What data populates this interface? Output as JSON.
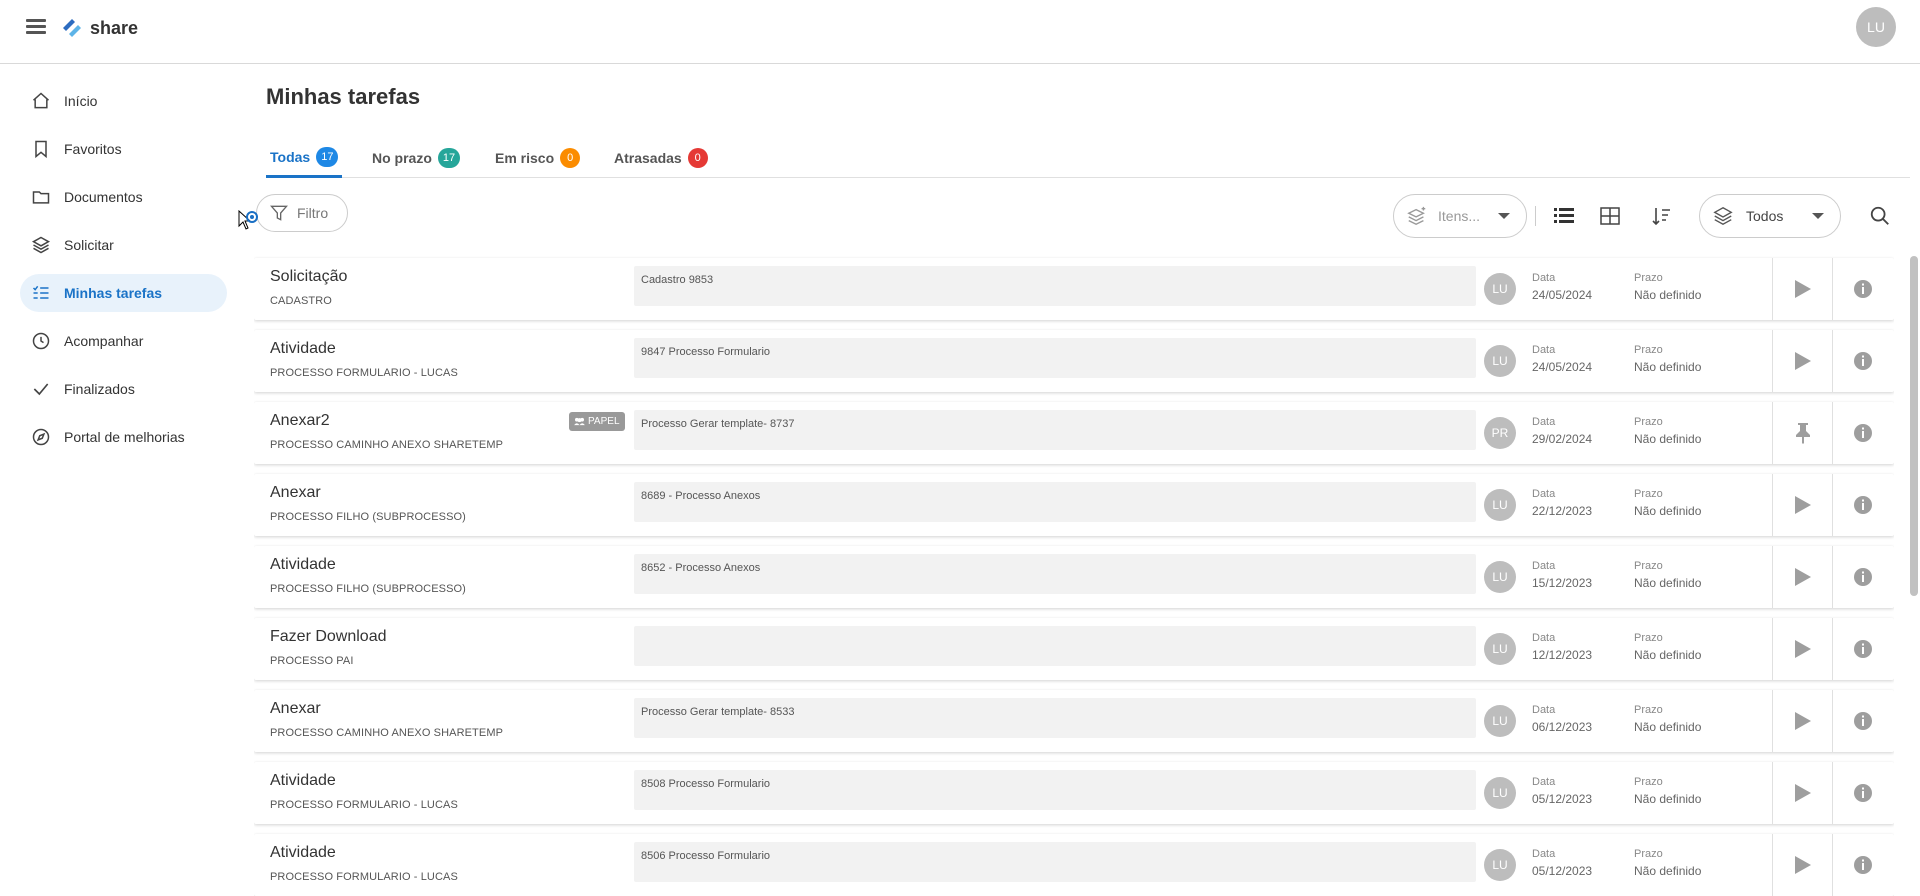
{
  "app": {
    "name": "share",
    "user_initials": "LU"
  },
  "sidebar": {
    "items": [
      {
        "label": "Início",
        "icon": "home-icon"
      },
      {
        "label": "Favoritos",
        "icon": "bookmark-icon"
      },
      {
        "label": "Documentos",
        "icon": "folder-icon"
      },
      {
        "label": "Solicitar",
        "icon": "layers-icon"
      },
      {
        "label": "Minhas tarefas",
        "icon": "task-list-icon",
        "active": true
      },
      {
        "label": "Acompanhar",
        "icon": "clock-icon"
      },
      {
        "label": "Finalizados",
        "icon": "check-icon"
      },
      {
        "label": "Portal de melhorias",
        "icon": "compass-icon"
      }
    ]
  },
  "page": {
    "title": "Minhas tarefas"
  },
  "tabs": [
    {
      "label": "Todas",
      "count": "17",
      "color": "#1e88e5"
    },
    {
      "label": "No prazo",
      "count": "17",
      "color": "#26a69a"
    },
    {
      "label": "Em risco",
      "count": "0",
      "color": "#fb8c00"
    },
    {
      "label": "Atrasadas",
      "count": "0",
      "color": "#e53935"
    }
  ],
  "toolbar": {
    "filter_label": "Filtro",
    "items_select": "Itens...",
    "scope_select": "Todos"
  },
  "tasks": [
    {
      "title": "Solicitação",
      "subtitle": "CADASTRO",
      "description": "Cadastro 9853",
      "initials": "LU",
      "date_label": "Data",
      "date": "24/05/2024",
      "deadline_label": "Prazo",
      "deadline": "Não definido",
      "action": "play-icon"
    },
    {
      "title": "Atividade",
      "subtitle": "PROCESSO FORMULARIO - LUCAS",
      "description": "9847 Processo Formulario",
      "initials": "LU",
      "date_label": "Data",
      "date": "24/05/2024",
      "deadline_label": "Prazo",
      "deadline": "Não definido",
      "action": "play-icon"
    },
    {
      "title": "Anexar2",
      "subtitle": "PROCESSO CAMINHO ANEXO SHARETEMP",
      "description": "Processo Gerar template- 8737",
      "initials": "PR",
      "date_label": "Data",
      "date": "29/02/2024",
      "deadline_label": "Prazo",
      "deadline": "Não definido",
      "action": "pin-icon",
      "tag": "PAPEL"
    },
    {
      "title": "Anexar",
      "subtitle": "PROCESSO FILHO (SUBPROCESSO)",
      "description": "8689 - Processo Anexos",
      "initials": "LU",
      "date_label": "Data",
      "date": "22/12/2023",
      "deadline_label": "Prazo",
      "deadline": "Não definido",
      "action": "play-icon"
    },
    {
      "title": "Atividade",
      "subtitle": "PROCESSO FILHO (SUBPROCESSO)",
      "description": "8652 - Processo Anexos",
      "initials": "LU",
      "date_label": "Data",
      "date": "15/12/2023",
      "deadline_label": "Prazo",
      "deadline": "Não definido",
      "action": "play-icon"
    },
    {
      "title": "Fazer Download",
      "subtitle": "PROCESSO PAI",
      "description": "",
      "initials": "LU",
      "date_label": "Data",
      "date": "12/12/2023",
      "deadline_label": "Prazo",
      "deadline": "Não definido",
      "action": "play-icon"
    },
    {
      "title": "Anexar",
      "subtitle": "PROCESSO CAMINHO ANEXO SHARETEMP",
      "description": "Processo Gerar template- 8533",
      "initials": "LU",
      "date_label": "Data",
      "date": "06/12/2023",
      "deadline_label": "Prazo",
      "deadline": "Não definido",
      "action": "play-icon"
    },
    {
      "title": "Atividade",
      "subtitle": "PROCESSO FORMULARIO - LUCAS",
      "description": "8508 Processo Formulario",
      "initials": "LU",
      "date_label": "Data",
      "date": "05/12/2023",
      "deadline_label": "Prazo",
      "deadline": "Não definido",
      "action": "play-icon"
    },
    {
      "title": "Atividade",
      "subtitle": "PROCESSO FORMULARIO - LUCAS",
      "description": "8506 Processo Formulario",
      "initials": "LU",
      "date_label": "Data",
      "date": "05/12/2023",
      "deadline_label": "Prazo",
      "deadline": "Não definido",
      "action": "play-icon"
    }
  ],
  "colors": {
    "accent": "#1a73c7",
    "active_bg": "#e8f2fb",
    "avatar": "#bdbdbd"
  }
}
